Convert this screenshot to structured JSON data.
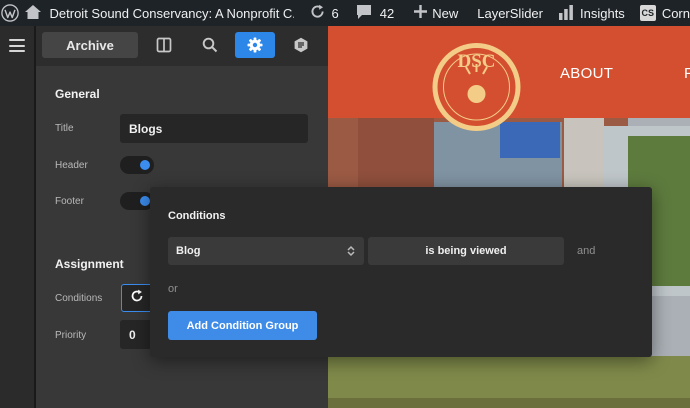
{
  "adminbar": {
    "site_title": "Detroit Sound Conservancy: A Nonprofit C...",
    "updates_count": "6",
    "comments_count": "42",
    "new_label": "New",
    "layerslider_label": "LayerSlider",
    "insights_label": "Insights",
    "cs_badge": "CS",
    "cornerstone_label": "Corn"
  },
  "toolbar": {
    "archive_label": "Archive"
  },
  "general": {
    "heading": "General",
    "title_label": "Title",
    "title_value": "Blogs",
    "header_label": "Header",
    "footer_label": "Footer"
  },
  "assignment": {
    "heading": "Assignment",
    "conditions_label": "Conditions",
    "priority_label": "Priority",
    "priority_value": "0"
  },
  "preview": {
    "logo_text": "DSC",
    "nav_about": "ABOUT",
    "nav_partial": "P"
  },
  "conditions_popup": {
    "title": "Conditions",
    "condition_value": "Blog",
    "operator_value": "is being viewed",
    "and_label": "and",
    "or_label": "or",
    "add_group_label": "Add Condition Group"
  },
  "colors": {
    "accent_blue": "#3b8df0",
    "site_orange": "#d44f30",
    "admin_bar": "#1d2327"
  }
}
